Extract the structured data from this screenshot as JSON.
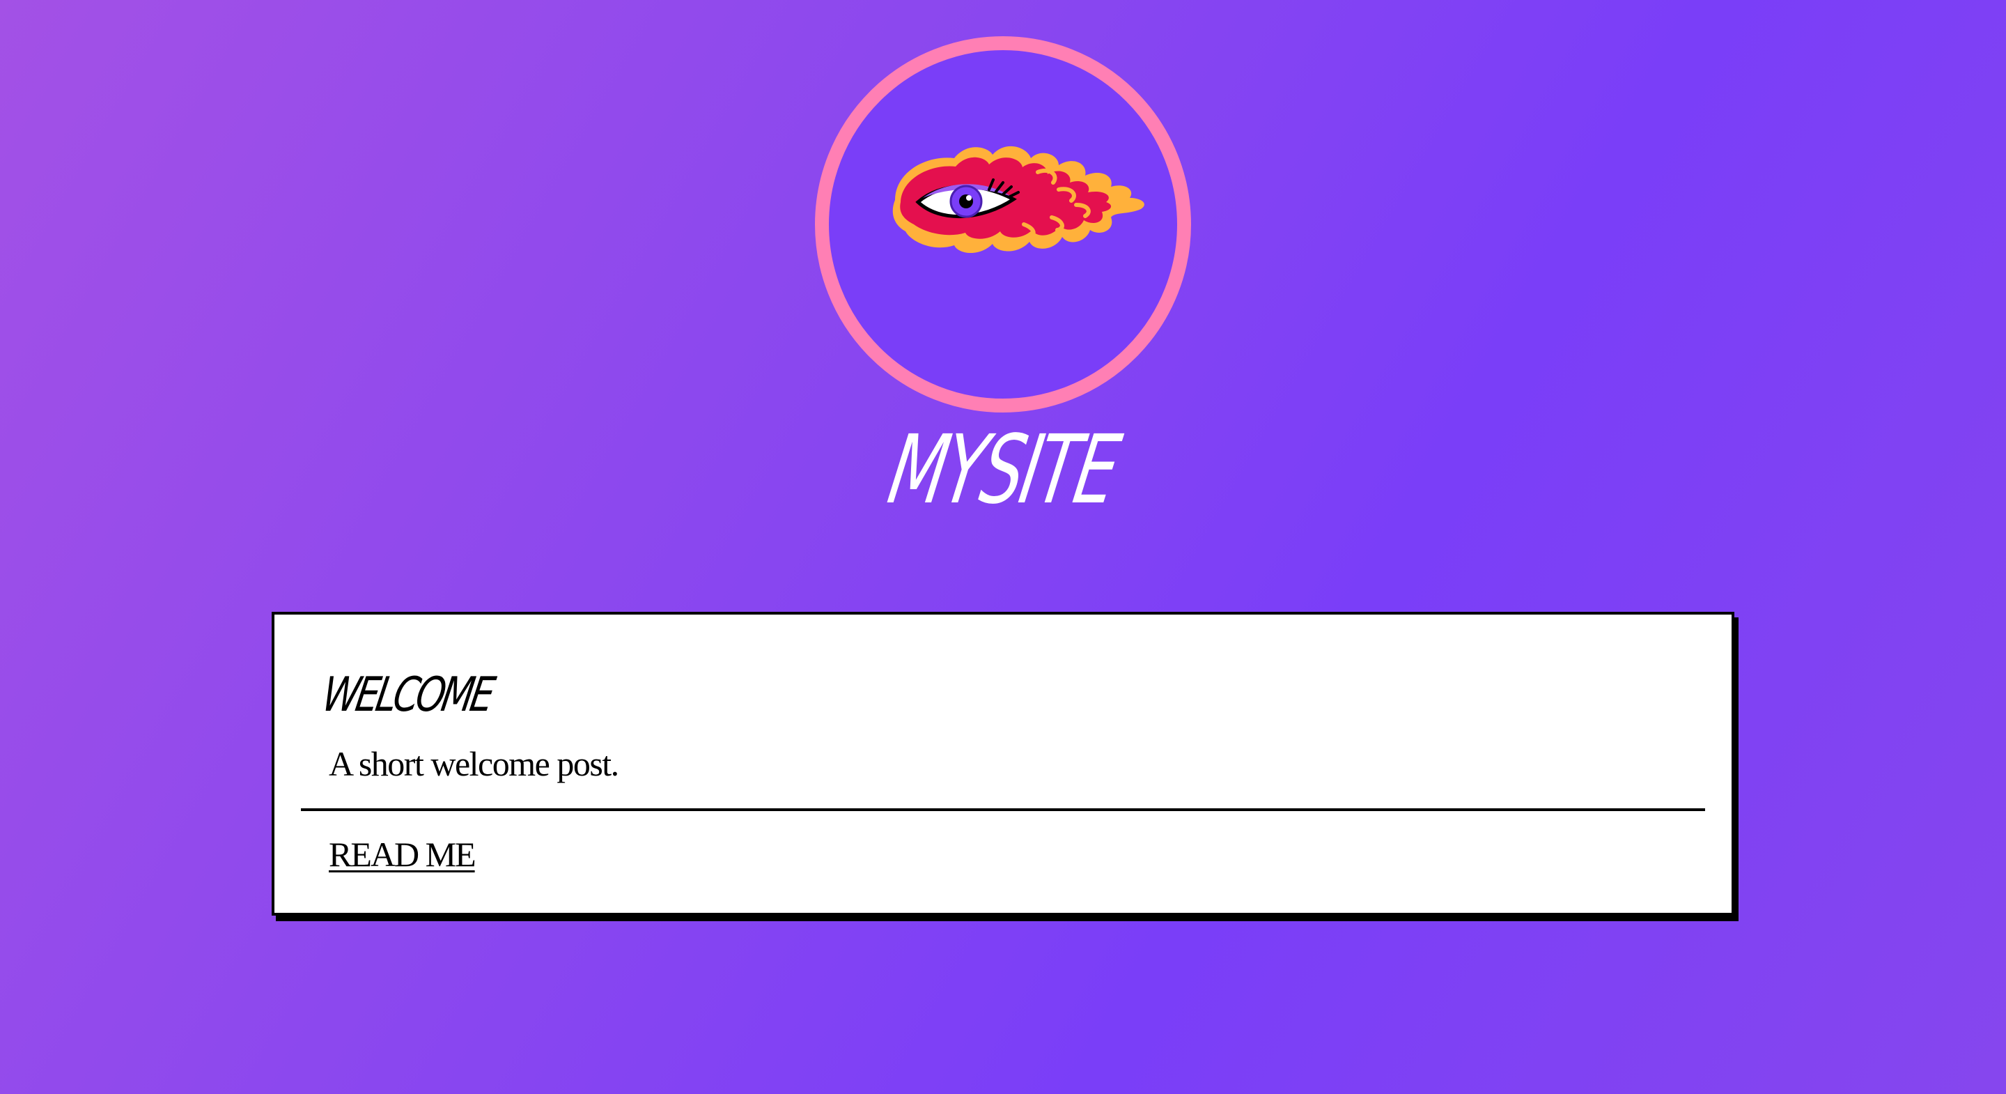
{
  "header": {
    "site_title": "MYSITE",
    "logo_icon": "flaming-eye-icon",
    "logo_ring_color": "#ff7fb4",
    "logo_fill_color": "#7a3ef8"
  },
  "posts": [
    {
      "title": "WELCOME",
      "excerpt": "A short welcome post.",
      "link_label": "READ ME"
    }
  ],
  "colors": {
    "background_start": "#a351e6",
    "background_end": "#7a3ef8",
    "card_background": "#ffffff",
    "text": "#000000"
  }
}
